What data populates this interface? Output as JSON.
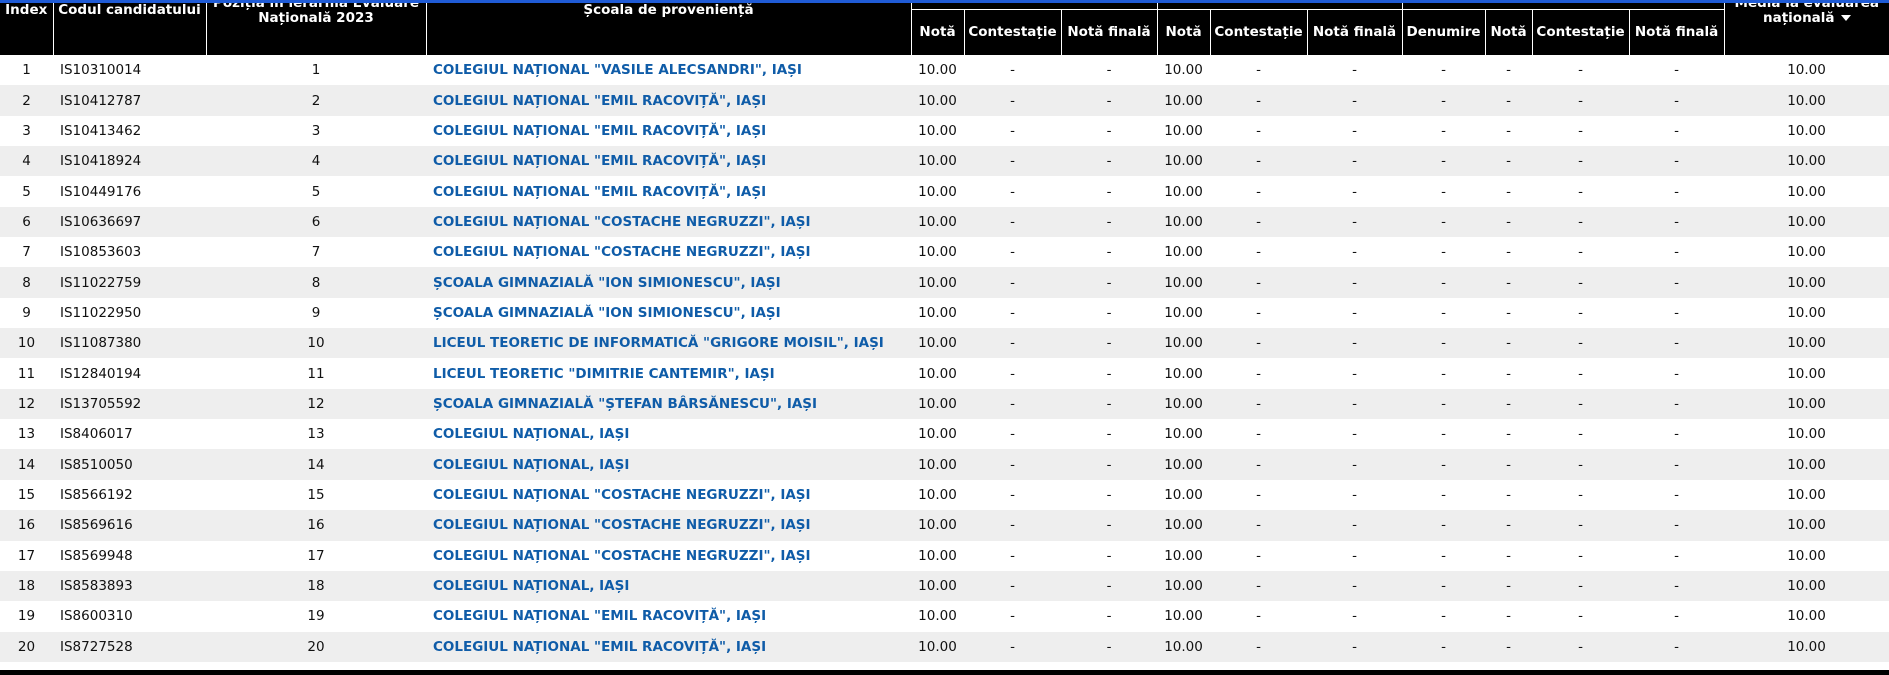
{
  "header": {
    "index": "Index",
    "code": "Codul candidatului",
    "position_line1": "Poziția în ierarhia Evaluare",
    "position_line2": "Națională 2023",
    "school": "Școala de proveniență",
    "g1_nota": "Notă",
    "g1_contestatie": "Contestație",
    "g1_nota_finala": "Notă finală",
    "g2_nota": "Notă",
    "g2_contestatie": "Contestație",
    "g2_nota_finala": "Notă finală",
    "g3_denumire": "Denumire",
    "g3_nota": "Notă",
    "g3_contestatie": "Contestație",
    "g3_nota_finala": "Notă finală",
    "media_line1": "Media la evaluarea",
    "media_line2": "națională"
  },
  "rows": [
    {
      "index": "1",
      "code": "IS10310014",
      "position": "1",
      "school": "COLEGIUL NAȚIONAL \"VASILE ALECSANDRI\", IAȘI",
      "n1": "10.00",
      "c1": "-",
      "f1": "-",
      "n2": "10.00",
      "c2": "-",
      "f2": "-",
      "den": "-",
      "n3": "-",
      "c3": "-",
      "f3": "-",
      "media": "10.00"
    },
    {
      "index": "2",
      "code": "IS10412787",
      "position": "2",
      "school": "COLEGIUL NAȚIONAL \"EMIL RACOVIȚĂ\", IAȘI",
      "n1": "10.00",
      "c1": "-",
      "f1": "-",
      "n2": "10.00",
      "c2": "-",
      "f2": "-",
      "den": "-",
      "n3": "-",
      "c3": "-",
      "f3": "-",
      "media": "10.00"
    },
    {
      "index": "3",
      "code": "IS10413462",
      "position": "3",
      "school": "COLEGIUL NAȚIONAL \"EMIL RACOVIȚĂ\", IAȘI",
      "n1": "10.00",
      "c1": "-",
      "f1": "-",
      "n2": "10.00",
      "c2": "-",
      "f2": "-",
      "den": "-",
      "n3": "-",
      "c3": "-",
      "f3": "-",
      "media": "10.00"
    },
    {
      "index": "4",
      "code": "IS10418924",
      "position": "4",
      "school": "COLEGIUL NAȚIONAL \"EMIL RACOVIȚĂ\", IAȘI",
      "n1": "10.00",
      "c1": "-",
      "f1": "-",
      "n2": "10.00",
      "c2": "-",
      "f2": "-",
      "den": "-",
      "n3": "-",
      "c3": "-",
      "f3": "-",
      "media": "10.00"
    },
    {
      "index": "5",
      "code": "IS10449176",
      "position": "5",
      "school": "COLEGIUL NAȚIONAL \"EMIL RACOVIȚĂ\", IAȘI",
      "n1": "10.00",
      "c1": "-",
      "f1": "-",
      "n2": "10.00",
      "c2": "-",
      "f2": "-",
      "den": "-",
      "n3": "-",
      "c3": "-",
      "f3": "-",
      "media": "10.00"
    },
    {
      "index": "6",
      "code": "IS10636697",
      "position": "6",
      "school": "COLEGIUL NAȚIONAL \"COSTACHE NEGRUZZI\", IAȘI",
      "n1": "10.00",
      "c1": "-",
      "f1": "-",
      "n2": "10.00",
      "c2": "-",
      "f2": "-",
      "den": "-",
      "n3": "-",
      "c3": "-",
      "f3": "-",
      "media": "10.00"
    },
    {
      "index": "7",
      "code": "IS10853603",
      "position": "7",
      "school": "COLEGIUL NAȚIONAL \"COSTACHE NEGRUZZI\", IAȘI",
      "n1": "10.00",
      "c1": "-",
      "f1": "-",
      "n2": "10.00",
      "c2": "-",
      "f2": "-",
      "den": "-",
      "n3": "-",
      "c3": "-",
      "f3": "-",
      "media": "10.00"
    },
    {
      "index": "8",
      "code": "IS11022759",
      "position": "8",
      "school": "ȘCOALA GIMNAZIALĂ \"ION SIMIONESCU\", IAȘI",
      "n1": "10.00",
      "c1": "-",
      "f1": "-",
      "n2": "10.00",
      "c2": "-",
      "f2": "-",
      "den": "-",
      "n3": "-",
      "c3": "-",
      "f3": "-",
      "media": "10.00"
    },
    {
      "index": "9",
      "code": "IS11022950",
      "position": "9",
      "school": "ȘCOALA GIMNAZIALĂ \"ION SIMIONESCU\", IAȘI",
      "n1": "10.00",
      "c1": "-",
      "f1": "-",
      "n2": "10.00",
      "c2": "-",
      "f2": "-",
      "den": "-",
      "n3": "-",
      "c3": "-",
      "f3": "-",
      "media": "10.00"
    },
    {
      "index": "10",
      "code": "IS11087380",
      "position": "10",
      "school": "LICEUL TEORETIC DE INFORMATICĂ \"GRIGORE MOISIL\", IAȘI",
      "n1": "10.00",
      "c1": "-",
      "f1": "-",
      "n2": "10.00",
      "c2": "-",
      "f2": "-",
      "den": "-",
      "n3": "-",
      "c3": "-",
      "f3": "-",
      "media": "10.00"
    },
    {
      "index": "11",
      "code": "IS12840194",
      "position": "11",
      "school": "LICEUL TEORETIC \"DIMITRIE CANTEMIR\", IAȘI",
      "n1": "10.00",
      "c1": "-",
      "f1": "-",
      "n2": "10.00",
      "c2": "-",
      "f2": "-",
      "den": "-",
      "n3": "-",
      "c3": "-",
      "f3": "-",
      "media": "10.00"
    },
    {
      "index": "12",
      "code": "IS13705592",
      "position": "12",
      "school": "ȘCOALA GIMNAZIALĂ \"ȘTEFAN BÂRSĂNESCU\", IAȘI",
      "n1": "10.00",
      "c1": "-",
      "f1": "-",
      "n2": "10.00",
      "c2": "-",
      "f2": "-",
      "den": "-",
      "n3": "-",
      "c3": "-",
      "f3": "-",
      "media": "10.00"
    },
    {
      "index": "13",
      "code": "IS8406017",
      "position": "13",
      "school": "COLEGIUL NAȚIONAL, IAȘI",
      "n1": "10.00",
      "c1": "-",
      "f1": "-",
      "n2": "10.00",
      "c2": "-",
      "f2": "-",
      "den": "-",
      "n3": "-",
      "c3": "-",
      "f3": "-",
      "media": "10.00"
    },
    {
      "index": "14",
      "code": "IS8510050",
      "position": "14",
      "school": "COLEGIUL NAȚIONAL, IAȘI",
      "n1": "10.00",
      "c1": "-",
      "f1": "-",
      "n2": "10.00",
      "c2": "-",
      "f2": "-",
      "den": "-",
      "n3": "-",
      "c3": "-",
      "f3": "-",
      "media": "10.00"
    },
    {
      "index": "15",
      "code": "IS8566192",
      "position": "15",
      "school": "COLEGIUL NAȚIONAL \"COSTACHE NEGRUZZI\", IAȘI",
      "n1": "10.00",
      "c1": "-",
      "f1": "-",
      "n2": "10.00",
      "c2": "-",
      "f2": "-",
      "den": "-",
      "n3": "-",
      "c3": "-",
      "f3": "-",
      "media": "10.00"
    },
    {
      "index": "16",
      "code": "IS8569616",
      "position": "16",
      "school": "COLEGIUL NAȚIONAL \"COSTACHE NEGRUZZI\", IAȘI",
      "n1": "10.00",
      "c1": "-",
      "f1": "-",
      "n2": "10.00",
      "c2": "-",
      "f2": "-",
      "den": "-",
      "n3": "-",
      "c3": "-",
      "f3": "-",
      "media": "10.00"
    },
    {
      "index": "17",
      "code": "IS8569948",
      "position": "17",
      "school": "COLEGIUL NAȚIONAL \"COSTACHE NEGRUZZI\", IAȘI",
      "n1": "10.00",
      "c1": "-",
      "f1": "-",
      "n2": "10.00",
      "c2": "-",
      "f2": "-",
      "den": "-",
      "n3": "-",
      "c3": "-",
      "f3": "-",
      "media": "10.00"
    },
    {
      "index": "18",
      "code": "IS8583893",
      "position": "18",
      "school": "COLEGIUL NAȚIONAL, IAȘI",
      "n1": "10.00",
      "c1": "-",
      "f1": "-",
      "n2": "10.00",
      "c2": "-",
      "f2": "-",
      "den": "-",
      "n3": "-",
      "c3": "-",
      "f3": "-",
      "media": "10.00"
    },
    {
      "index": "19",
      "code": "IS8600310",
      "position": "19",
      "school": "COLEGIUL NAȚIONAL \"EMIL RACOVIȚĂ\", IAȘI",
      "n1": "10.00",
      "c1": "-",
      "f1": "-",
      "n2": "10.00",
      "c2": "-",
      "f2": "-",
      "den": "-",
      "n3": "-",
      "c3": "-",
      "f3": "-",
      "media": "10.00"
    },
    {
      "index": "20",
      "code": "IS8727528",
      "position": "20",
      "school": "COLEGIUL NAȚIONAL \"EMIL RACOVIȚĂ\", IAȘI",
      "n1": "10.00",
      "c1": "-",
      "f1": "-",
      "n2": "10.00",
      "c2": "-",
      "f2": "-",
      "den": "-",
      "n3": "-",
      "c3": "-",
      "f3": "-",
      "media": "10.00"
    }
  ]
}
